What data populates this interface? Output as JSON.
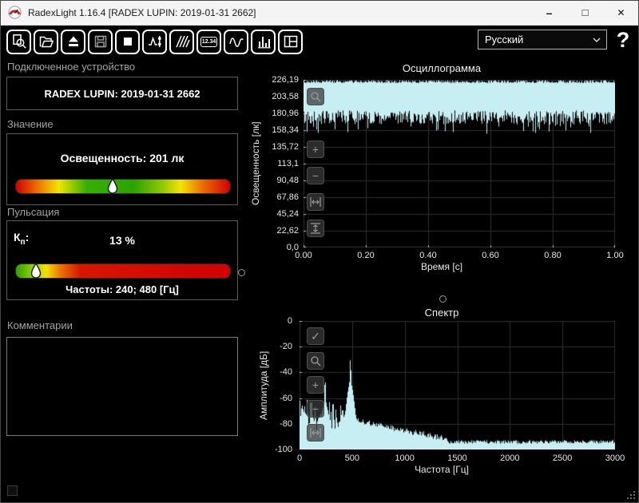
{
  "window": {
    "title": "RadexLight 1.16.4 [RADEX LUPIN: 2019-01-31 2662]",
    "minimize_glyph": "–",
    "maximize_glyph": "□",
    "close_glyph": "✕"
  },
  "toolbar": {
    "buttons": [
      {
        "name": "preview",
        "icon": "magnifier-document-icon"
      },
      {
        "name": "open",
        "icon": "open-folder-icon"
      },
      {
        "name": "eject",
        "icon": "eject-icon"
      },
      {
        "name": "save",
        "icon": "floppy-disk-icon"
      },
      {
        "name": "stop",
        "icon": "stop-square-icon"
      },
      {
        "name": "measure",
        "icon": "waveform-cursor-icon"
      },
      {
        "name": "filter",
        "icon": "comb-lines-icon"
      },
      {
        "name": "numeric-display",
        "icon": "numeric-display-icon",
        "label": "12.34"
      },
      {
        "name": "oscillogram-view",
        "icon": "wave-curve-icon"
      },
      {
        "name": "spectrum-view",
        "icon": "bar-spectrum-icon"
      },
      {
        "name": "layout",
        "icon": "panels-layout-icon"
      }
    ],
    "numeric_label": "12.34",
    "language": "Русский",
    "help": "?"
  },
  "left": {
    "device": {
      "header": "Подключенное устройство",
      "name": "RADEX LUPIN: 2019-01-31 2662"
    },
    "value": {
      "header": "Значение",
      "reading": "Освещенность: 201 лк",
      "marker_pct": 45,
      "gradient": [
        [
          "#cf0000",
          0
        ],
        [
          "#ec7000",
          10
        ],
        [
          "#f2e400",
          20
        ],
        [
          "#36b000",
          33
        ],
        [
          "#2ca300",
          55
        ],
        [
          "#8cc800",
          68
        ],
        [
          "#f2e400",
          77
        ],
        [
          "#ec7000",
          87
        ],
        [
          "#cf0000",
          100
        ]
      ]
    },
    "pulsation": {
      "header": "Пульсация",
      "kp_main": "К",
      "kp_sub": "п",
      "kp_colon": ":",
      "value": "13 %",
      "marker_pct": 9.5,
      "frequencies": "Частоты: 240; 480 [Гц]",
      "gradient": [
        [
          "#2ca300",
          0
        ],
        [
          "#8cc800",
          7
        ],
        [
          "#f2e400",
          14
        ],
        [
          "#ec7000",
          21
        ],
        [
          "#d81600",
          30
        ],
        [
          "#cf0000",
          100
        ]
      ]
    },
    "comments": {
      "header": "Комментарии",
      "text": ""
    }
  },
  "chart_data": [
    {
      "type": "area",
      "title": "Осциллограмма",
      "xlabel": "Время [с]",
      "ylabel": "Освещенность [лк]",
      "x_ticks": [
        "0.00",
        "0.20",
        "0.40",
        "0.60",
        "0.80",
        "1.00"
      ],
      "y_ticks": [
        "226,19",
        "203,58",
        "180,96",
        "158,34",
        "135,72",
        "113,1",
        "90,48",
        "67,86",
        "45,24",
        "22,62",
        "0,0"
      ],
      "xlim": [
        0,
        1
      ],
      "ylim": [
        0,
        226.19
      ],
      "grid": true,
      "series": [
        {
          "name": "Освещенность",
          "mean": 201,
          "band_top": 226.19,
          "band_bottom_min": 153,
          "band_bottom_max": 185
        }
      ],
      "tools": [
        "magnifier-icon",
        "zoom-in-icon",
        "zoom-out-icon",
        "fit-horizontal-icon",
        "fit-vertical-icon"
      ]
    },
    {
      "type": "area",
      "title": "Спектр",
      "xlabel": "Частота [Гц]",
      "ylabel": "Амплитуда [дБ]",
      "x_ticks": [
        "0",
        "500",
        "1000",
        "1500",
        "2000",
        "2500",
        "3000"
      ],
      "y_ticks": [
        "0",
        "-20",
        "-40",
        "-60",
        "-80",
        "-100"
      ],
      "xlim": [
        0,
        3000
      ],
      "ylim": [
        -100,
        0
      ],
      "grid": true,
      "peaks": [
        {
          "freq": 240,
          "amp_db": -46
        },
        {
          "freq": 480,
          "amp_db": -30
        }
      ],
      "noise": {
        "low_band_top_db": -63,
        "low_band_floor_db": -85,
        "hf_floor_db": -96
      },
      "tools": [
        "check-icon",
        "magnifier-icon",
        "zoom-in-icon",
        "zoom-out-icon",
        "fit-horizontal-icon"
      ]
    }
  ],
  "colors": {
    "trace": "#c7eef2",
    "grid": "#2e2e2e",
    "axis_text": "#e8e8e8"
  }
}
